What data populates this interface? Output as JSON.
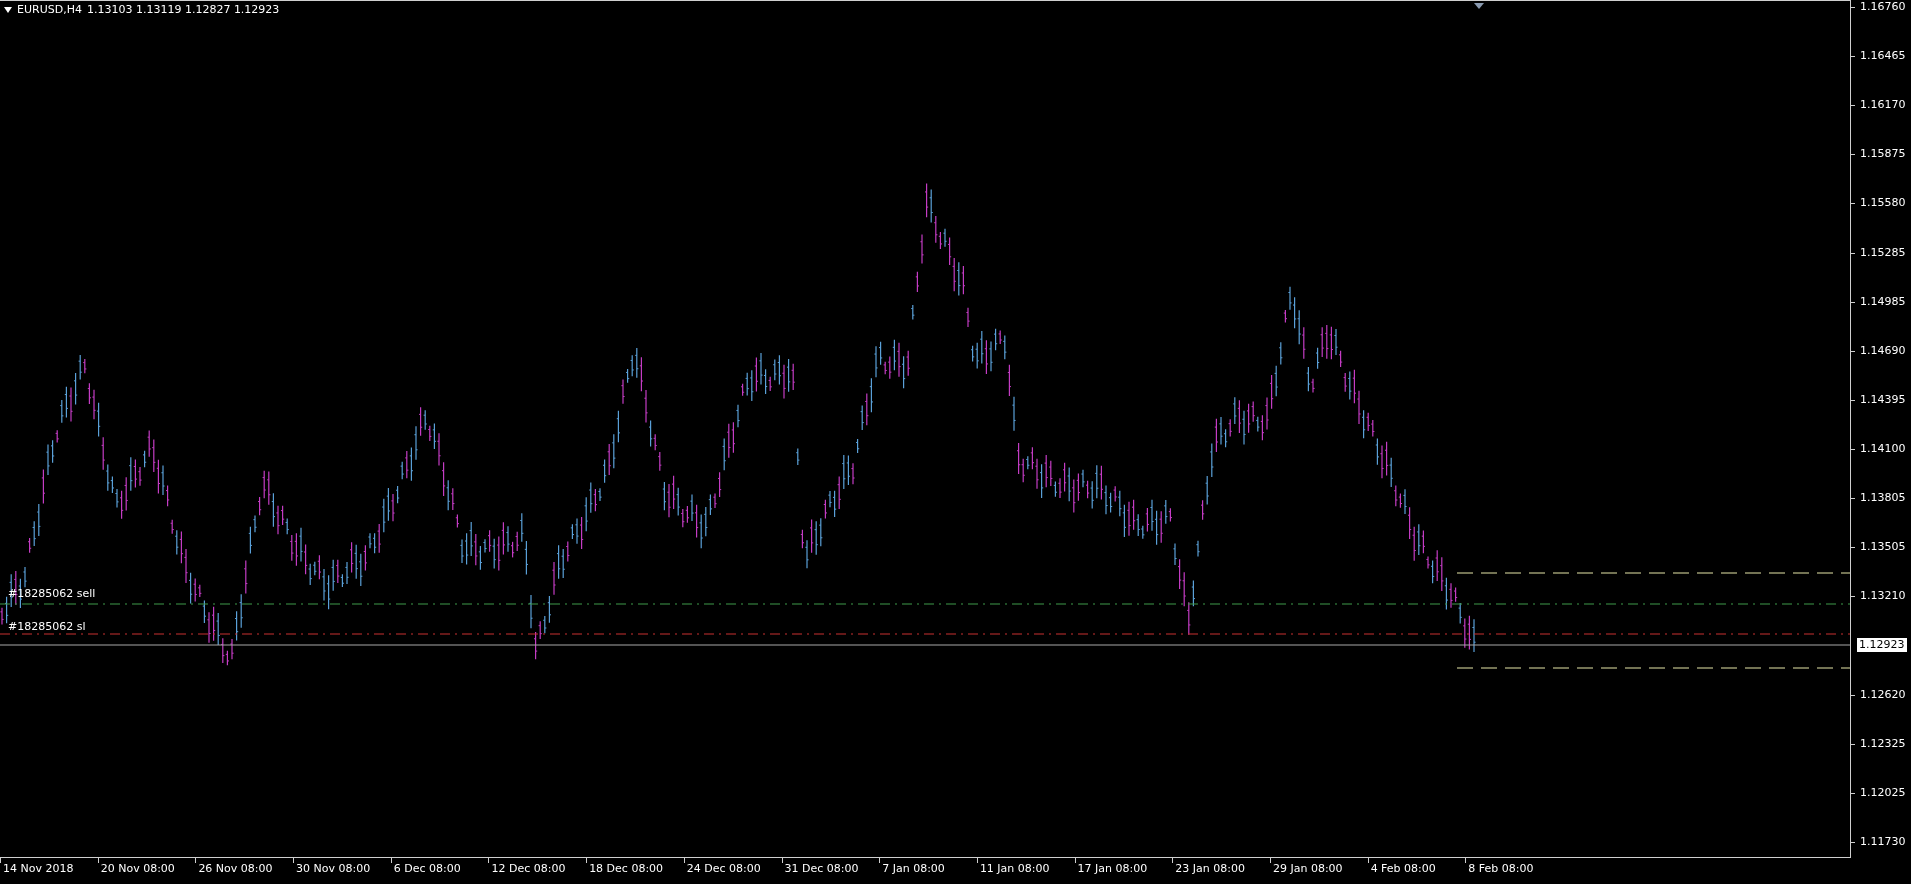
{
  "chart_header": {
    "symbol": "EURUSD,H4",
    "ohlc": "1.13103 1.13119 1.12827 1.12923"
  },
  "orders": [
    {
      "label": "#18285062 sell",
      "kind": "entry"
    },
    {
      "label": "#18285062 sl",
      "kind": "stop_loss"
    }
  ],
  "price_axis": {
    "labels": [
      {
        "text": "1.16760",
        "kind": "tick"
      },
      {
        "text": "1.16465",
        "kind": "tick"
      },
      {
        "text": "1.16170",
        "kind": "tick"
      },
      {
        "text": "1.15875",
        "kind": "tick"
      },
      {
        "text": "1.15580",
        "kind": "tick"
      },
      {
        "text": "1.15285",
        "kind": "tick"
      },
      {
        "text": "1.14985",
        "kind": "tick"
      },
      {
        "text": "1.14690",
        "kind": "tick"
      },
      {
        "text": "1.14395",
        "kind": "tick"
      },
      {
        "text": "1.14100",
        "kind": "tick"
      },
      {
        "text": "1.13805",
        "kind": "tick"
      },
      {
        "text": "1.13505",
        "kind": "tick"
      },
      {
        "text": "1.13210",
        "kind": "tick"
      },
      {
        "text": "1.12923",
        "kind": "current"
      },
      {
        "text": "1.12620",
        "kind": "tick"
      },
      {
        "text": "1.12325",
        "kind": "tick"
      },
      {
        "text": "1.12025",
        "kind": "tick"
      },
      {
        "text": "1.11730",
        "kind": "tick"
      }
    ]
  },
  "time_axis": {
    "labels": [
      "14 Nov 2018",
      "20 Nov 08:00",
      "26 Nov 08:00",
      "30 Nov 08:00",
      "6 Dec 08:00",
      "12 Dec 08:00",
      "18 Dec 08:00",
      "24 Dec 08:00",
      "31 Dec 08:00",
      "7 Jan 08:00",
      "11 Jan 08:00",
      "17 Jan 08:00",
      "23 Jan 08:00",
      "29 Jan 08:00",
      "4 Feb 08:00",
      "8 Feb 08:00"
    ]
  }
}
